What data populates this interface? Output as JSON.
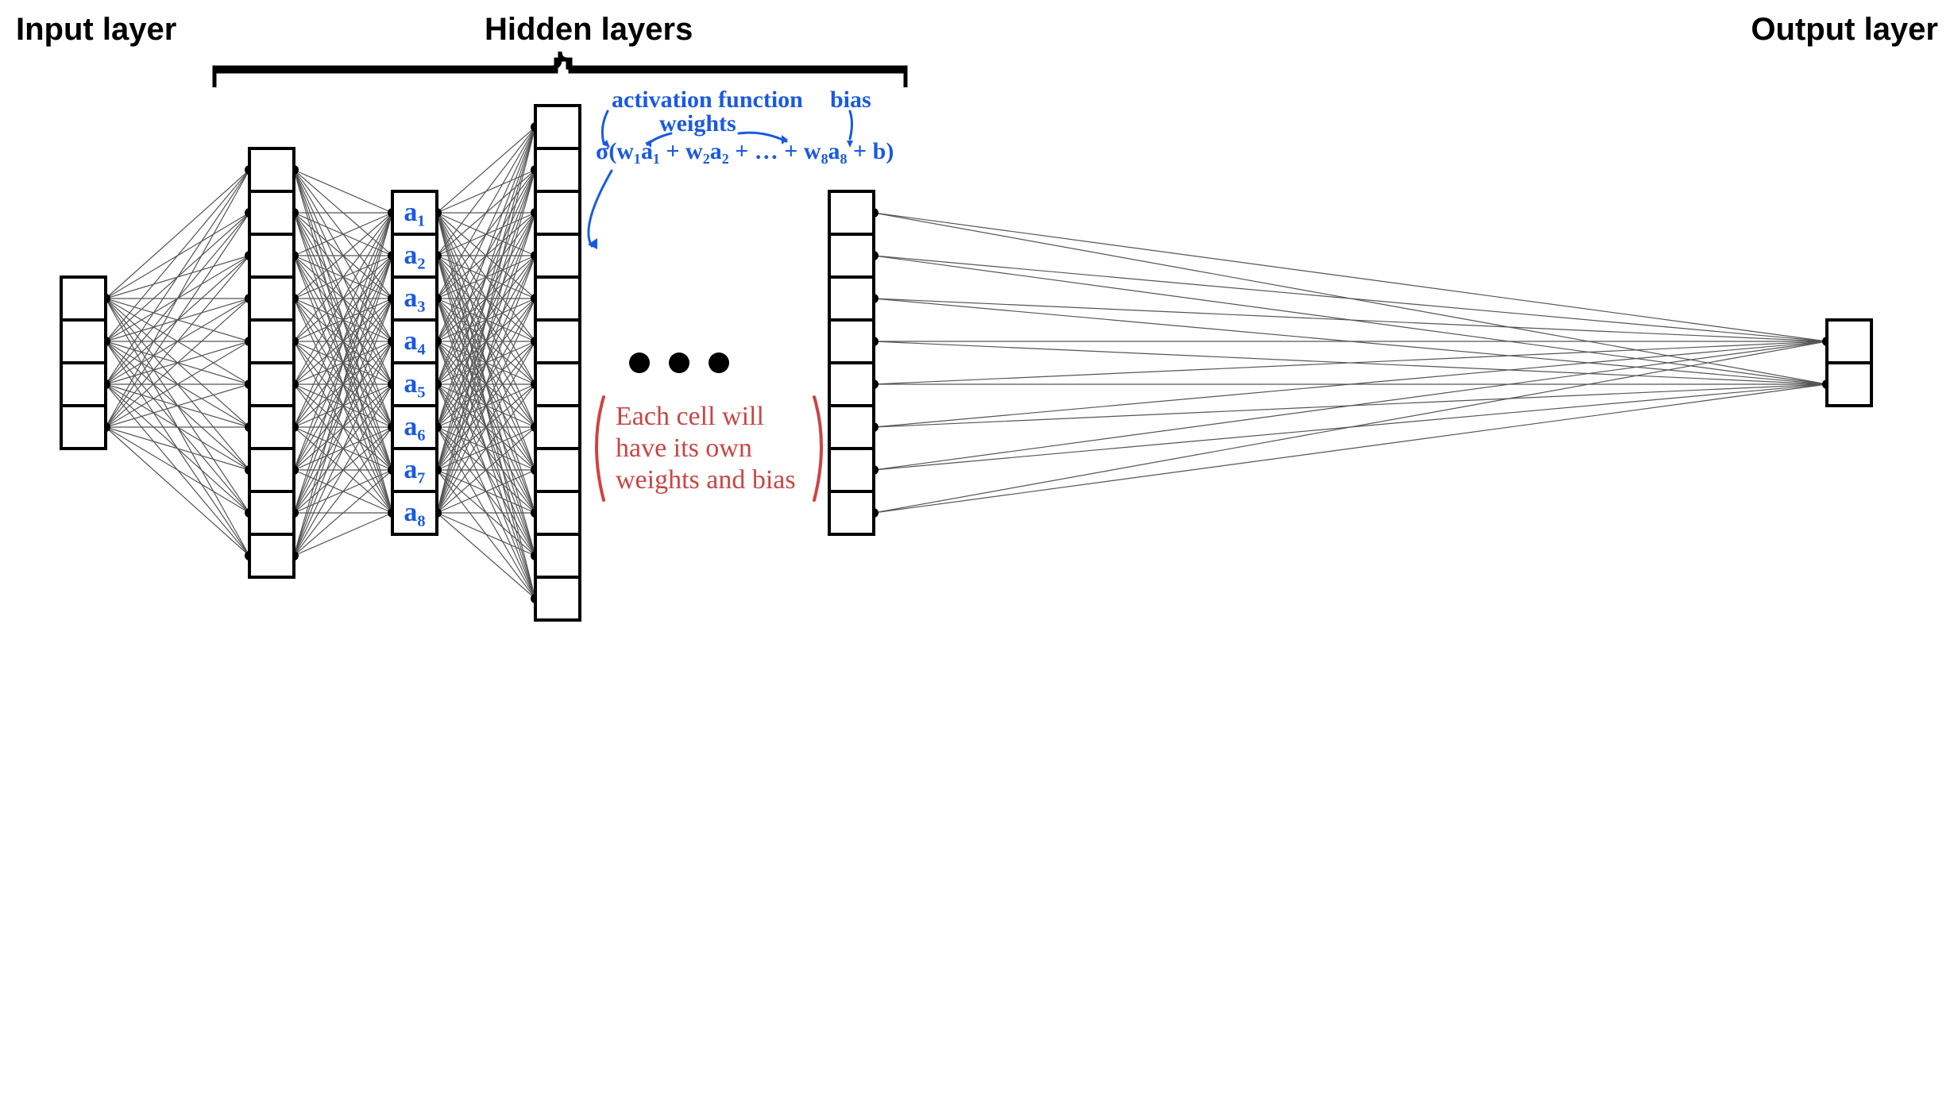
{
  "titles": {
    "input": "Input layer",
    "hidden": "Hidden layers",
    "output": "Output layer"
  },
  "layers": {
    "input": {
      "cells": 4
    },
    "h1": {
      "cells": 10
    },
    "h2": {
      "cells": 8,
      "labels": [
        "a₁",
        "a₂",
        "a₃",
        "a₄",
        "a₅",
        "a₆",
        "a₇",
        "a₈"
      ]
    },
    "h3": {
      "cells": 12
    },
    "hlast": {
      "cells": 8
    },
    "output": {
      "cells": 2
    }
  },
  "annotations": {
    "formula": "σ(w₁a₁ + w₂a₂ + … + w₈a₈ + b)",
    "activation_label": "activation function",
    "weights_label": "weights",
    "bias_label": "bias",
    "red_line1": "Each cell will",
    "red_line2": "have its own",
    "red_line3": "weights and bias"
  },
  "ellipsis": "● ● ●"
}
